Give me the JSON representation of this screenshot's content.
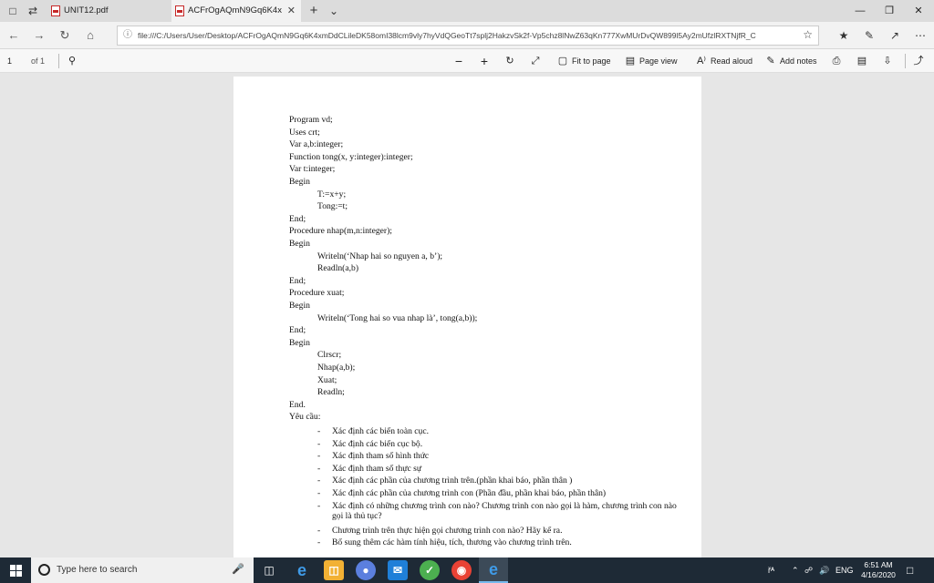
{
  "tabs": [
    {
      "label": "UNIT12.pdf",
      "active": false
    },
    {
      "label": "ACFrOgAQmN9Gq6K4x",
      "active": true
    }
  ],
  "address_bar": {
    "url": "file:///C:/Users/User/Desktop/ACFrOgAQmN9Gq6K4xmDdCLileDK58omI38lcm9vly7hyVdQGeoTt7splj2HakzvSk2f-Vp5chz8lNwZ63qKn777XwMUrDvQW899l5Ay2mUfzlRXTNjfR_C"
  },
  "pdf_toolbar": {
    "page_number": "1",
    "page_total": "of 1",
    "fit_to_page": "Fit to page",
    "page_view": "Page view",
    "read_aloud": "Read aloud",
    "add_notes": "Add notes"
  },
  "document": {
    "code_lines": [
      {
        "text": "Program vd;",
        "indent": false
      },
      {
        "text": "Uses crt;",
        "indent": false
      },
      {
        "text": "Var a,b:integer;",
        "indent": false
      },
      {
        "text": "Function tong(x, y:integer):integer;",
        "indent": false
      },
      {
        "text": "Var t:integer;",
        "indent": false
      },
      {
        "text": "Begin",
        "indent": false
      },
      {
        "text": "T:=x+y;",
        "indent": true
      },
      {
        "text": "Tong:=t;",
        "indent": true
      },
      {
        "text": "End;",
        "indent": false
      },
      {
        "text": "Procedure nhap(m,n:integer);",
        "indent": false
      },
      {
        "text": "Begin",
        "indent": false
      },
      {
        "text": "Writeln(‘Nhap hai so nguyen a, b’);",
        "indent": true
      },
      {
        "text": "Readln(a,b)",
        "indent": true
      },
      {
        "text": "End;",
        "indent": false
      },
      {
        "text": "Procedure xuat;",
        "indent": false
      },
      {
        "text": "Begin",
        "indent": false
      },
      {
        "text": "Writeln(‘Tong hai so vua nhap là’, tong(a,b));",
        "indent": true
      },
      {
        "text": "End;",
        "indent": false
      },
      {
        "text": "Begin",
        "indent": false
      },
      {
        "text": "Clrscr;",
        "indent": true
      },
      {
        "text": "Nhap(a,b);",
        "indent": true
      },
      {
        "text": "Xuat;",
        "indent": true
      },
      {
        "text": "Readln;",
        "indent": true
      },
      {
        "text": "End.",
        "indent": false
      },
      {
        "text": "Yêu cầu:",
        "indent": false
      }
    ],
    "requirements": [
      "Xác định các biến toàn cục.",
      "Xác định các biến cục bộ.",
      "Xác định tham số hình thức",
      "Xác định tham số thực sự",
      "Xác định các phần của chương trình trên.(phần khai báo, phần thân )",
      "Xác định các phần của chương trình con (Phần đầu, phần khai báo, phần thân)",
      "Xác định có những chương trình con nào? Chương trình con nào gọi là hàm, chương trình con nào gọi là thủ tục?",
      "Chương trình trên thực hiện gọi chương trình con nào? Hãy kể ra.",
      "Bổ sung thêm các hàm tính hiệu, tích, thương vào chương trình trên."
    ],
    "bullet_char": "-"
  },
  "taskbar": {
    "search_placeholder": "Type here to search",
    "language": "ENG",
    "time": "6:51 AM",
    "date": "4/16/2020"
  }
}
